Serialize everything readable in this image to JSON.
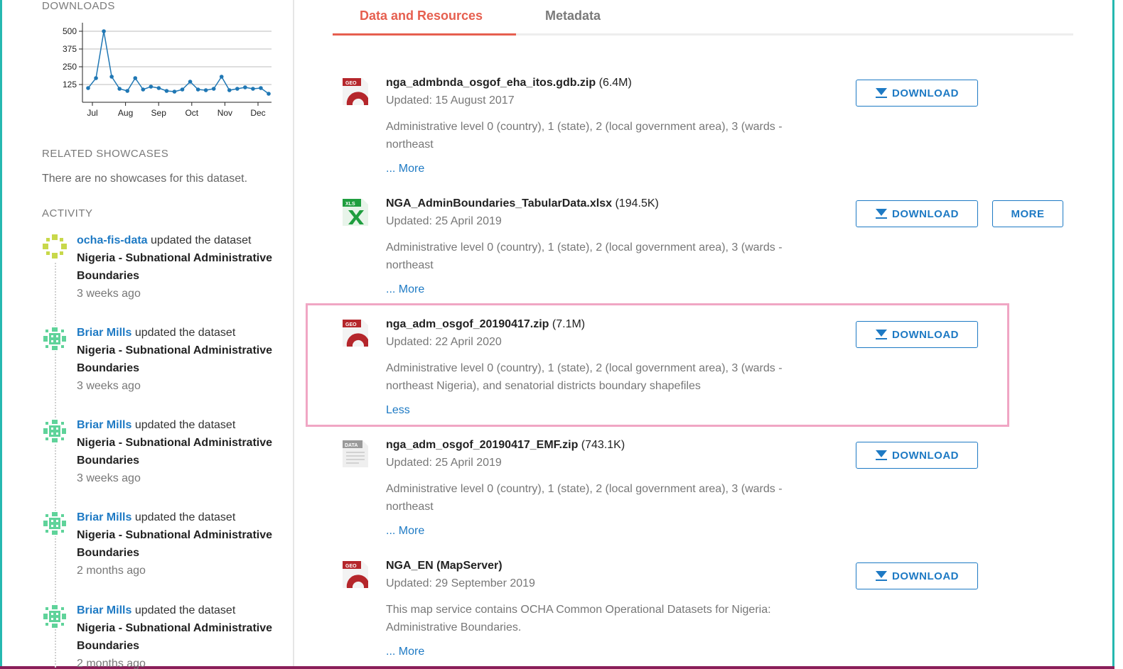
{
  "sidebar": {
    "downloads_heading": "DOWNLOADS",
    "related_heading": "RELATED SHOWCASES",
    "no_showcases": "There are no showcases for this dataset.",
    "activity_heading": "ACTIVITY",
    "activity": [
      {
        "user": "ocha-fis-data",
        "action": "updated the dataset",
        "dataset": "Nigeria - Subnational Administrative Boundaries",
        "time": "3 weeks ago"
      },
      {
        "user": "Briar Mills",
        "action": "updated the dataset",
        "dataset": "Nigeria - Subnational Administrative Boundaries",
        "time": "3 weeks ago"
      },
      {
        "user": "Briar Mills",
        "action": "updated the dataset",
        "dataset": "Nigeria - Subnational Administrative Boundaries",
        "time": "3 weeks ago"
      },
      {
        "user": "Briar Mills",
        "action": "updated the dataset",
        "dataset": "Nigeria - Subnational Administrative Boundaries",
        "time": "2 months ago"
      },
      {
        "user": "Briar Mills",
        "action": "updated the dataset",
        "dataset": "Nigeria - Subnational Administrative Boundaries",
        "time": "2 months ago"
      }
    ]
  },
  "chart_data": {
    "type": "line",
    "title": "",
    "xlabel": "",
    "ylabel": "",
    "y_ticks": [
      125,
      250,
      375,
      500
    ],
    "ylim": [
      0,
      540
    ],
    "x_tick_labels": [
      "Jul",
      "Aug",
      "Sep",
      "Oct",
      "Nov",
      "Dec"
    ],
    "grid": true,
    "color": "#1f77b4",
    "values": [
      100,
      170,
      500,
      180,
      95,
      80,
      170,
      90,
      110,
      100,
      80,
      75,
      90,
      145,
      90,
      85,
      95,
      180,
      85,
      95,
      105,
      95,
      100,
      60
    ]
  },
  "tabs": [
    {
      "label": "Data and Resources",
      "active": true
    },
    {
      "label": "Metadata",
      "active": false
    }
  ],
  "resources": [
    {
      "icon": "geo-file-icon",
      "icon_label": "GEO",
      "name": "nga_admbnda_osgof_eha_itos.gdb.zip",
      "size": "(6.4M)",
      "updated": "Updated: 15 August 2017",
      "description": "Administrative level 0 (country), 1 (state), 2 (local government area), 3 (wards - northeast",
      "toggle": "... More",
      "download_label": "DOWNLOAD"
    },
    {
      "icon": "xls-file-icon",
      "icon_label": "XLS",
      "name": "NGA_AdminBoundaries_TabularData.xlsx",
      "size": "(194.5K)",
      "updated": "Updated: 25 April 2019",
      "description": "Administrative level 0 (country), 1 (state), 2 (local government area), 3 (wards - northeast",
      "toggle": "... More",
      "download_label": "DOWNLOAD",
      "more_label": "MORE"
    },
    {
      "icon": "geo-file-icon",
      "icon_label": "GEO",
      "name": "nga_adm_osgof_20190417.zip",
      "size": "(7.1M)",
      "updated": "Updated: 22 April 2020",
      "description": "Administrative level 0 (country), 1 (state), 2 (local government area), 3 (wards - northeast Nigeria), and senatorial districts boundary shapefiles",
      "toggle": "Less",
      "download_label": "DOWNLOAD"
    },
    {
      "icon": "data-file-icon",
      "icon_label": "DATA",
      "name": "nga_adm_osgof_20190417_EMF.zip",
      "size": "(743.1K)",
      "updated": "Updated: 25 April 2019",
      "description": "Administrative level 0 (country), 1 (state), 2 (local government area), 3 (wards - northeast",
      "toggle": "... More",
      "download_label": "DOWNLOAD"
    },
    {
      "icon": "geo-file-icon",
      "icon_label": "GEO",
      "name": "NGA_EN (MapServer)",
      "size": "",
      "updated": "Updated: 29 September 2019",
      "description": "This map service contains OCHA Common Operational Datasets for Nigeria: Administrative Boundaries.",
      "toggle": "... More",
      "download_label": "DOWNLOAD"
    }
  ],
  "colors": {
    "accent": "#e65f4f",
    "link": "#1e7ac4",
    "highlight": "#f0a6c4"
  }
}
